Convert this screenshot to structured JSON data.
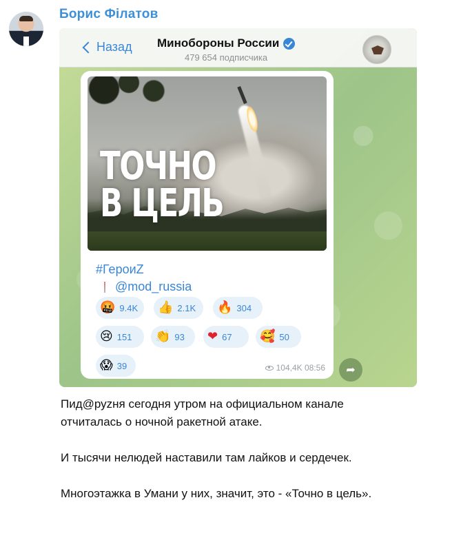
{
  "post": {
    "author": "Борис Філатов",
    "paragraphs": [
      "Пид@руzня сегодня утром на официальном канале отчиталась о ночной ракетной атаке.",
      "И тысячи нелюдей наставили там лайков и сердечек.",
      "Многоэтажка в Умани у них, значит, это - «Точно в цель»."
    ]
  },
  "telegram": {
    "back_label": "Назад",
    "channel_name": "Минобороны России",
    "subscribers": "479 654 подписчика",
    "photo_caption": "ТОЧНО В ЦЕЛЬ",
    "hashtag": "#ГероиZ",
    "mention": "@mod_russia",
    "reactions": [
      {
        "emoji": "🤬",
        "count": "9.4K"
      },
      {
        "emoji": "👍",
        "count": "2.1K"
      },
      {
        "emoji": "🔥",
        "count": "304"
      },
      {
        "emoji": "😢",
        "count": "151"
      },
      {
        "emoji": "👏",
        "count": "93"
      },
      {
        "emoji": "❤",
        "count": "67"
      },
      {
        "emoji": "🥰",
        "count": "50"
      },
      {
        "emoji": "😱",
        "count": "39"
      }
    ],
    "views_time": "104,4K 08:56",
    "colors": {
      "accent": "#3a86d6",
      "reaction_bg": "#e7f1fa",
      "author": "#3d8fd6"
    },
    "icons": [
      "back-chevron-icon",
      "verified-icon",
      "eye-icon",
      "share-icon"
    ]
  }
}
